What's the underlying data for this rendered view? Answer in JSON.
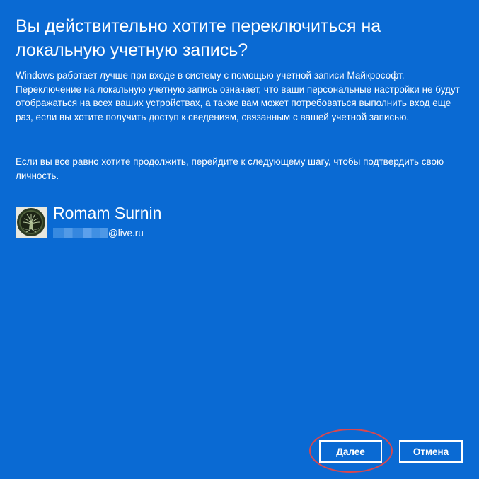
{
  "dialog": {
    "title": "Вы действительно хотите переключиться на локальную учетную запись?",
    "paragraph1": "Windows работает лучше при входе в систему с помощью учетной записи Майкрософт. Переключение на локальную учетную запись означает, что ваши персональные настройки не будут отображаться на всех ваших устройствах, а также вам может потребоваться выполнить вход еще раз, если вы хотите получить доступ к сведениям, связанным с вашей учетной записью.",
    "paragraph2": "Если вы все равно хотите продолжить, перейдите к следующему шагу, чтобы подтвердить свою личность."
  },
  "account": {
    "name": "Romam Surnin",
    "email_domain": "@live.ru",
    "avatar_icon": "tree-of-life-avatar"
  },
  "buttons": {
    "next_label": "Далее",
    "cancel_label": "Отмена"
  },
  "colors": {
    "background": "#0a6ad3",
    "text": "#ffffff",
    "annotation": "#d9474f"
  }
}
